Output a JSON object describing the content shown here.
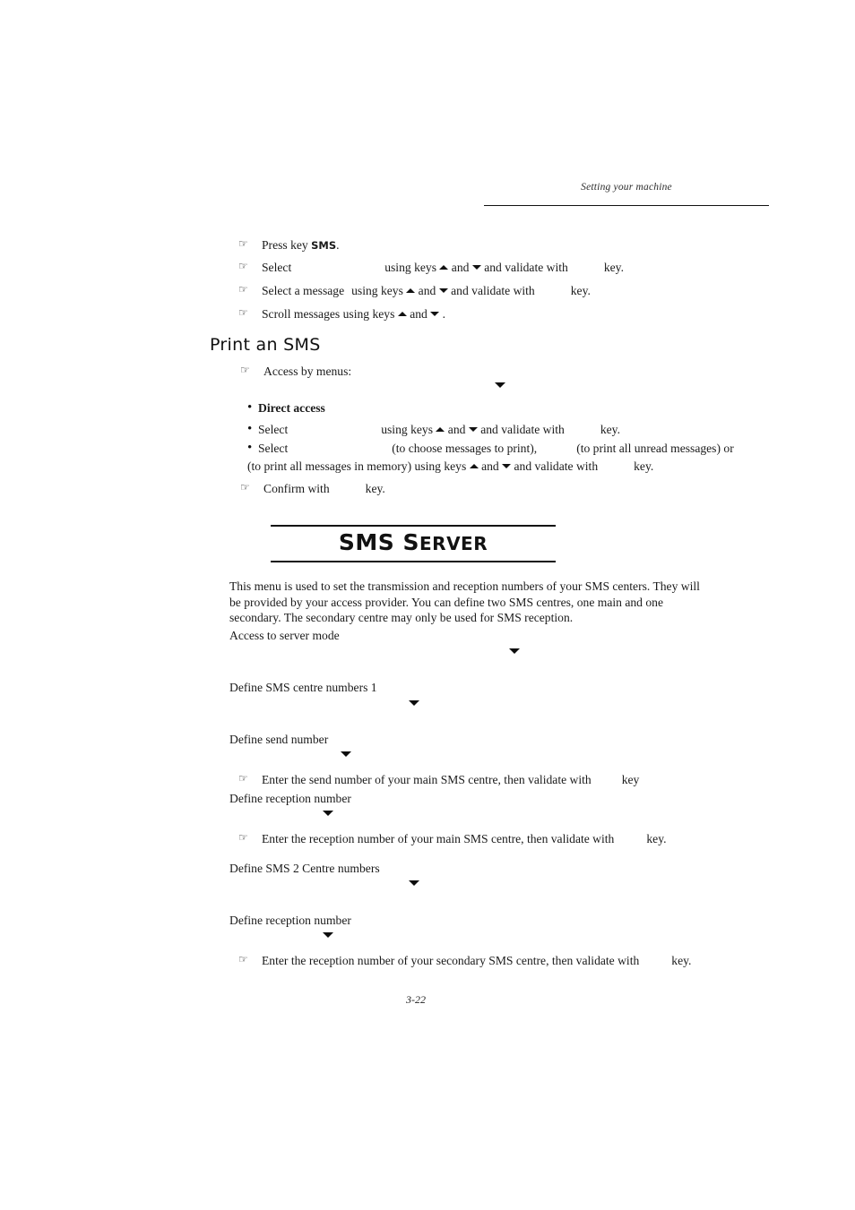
{
  "header": {
    "running_title": "Setting your machine"
  },
  "footer": {
    "page_number": "3-22"
  },
  "icons": {
    "hand": "☞",
    "bullet": "•",
    "key_up": "▲",
    "key_down": "▼",
    "menu_arrow": "▼"
  },
  "read_sms_steps": {
    "step1_pre": "Press key ",
    "step1_key": "SMS",
    "step1_post": ".",
    "step2_a": "Select",
    "step2_b": "using keys ",
    "step2_c": " and ",
    "step2_d": " and validate with",
    "step2_e": "key.",
    "step3_a": "Select a message",
    "step3_b": "using keys ",
    "step3_c": " and ",
    "step3_d": " and validate with",
    "step3_e": "key.",
    "step4_a": "Scroll messages using keys ",
    "step4_b": " and ",
    "step4_c": " ."
  },
  "print_sms": {
    "heading": "Print an SMS",
    "access_by_menus": "Access by menus:",
    "direct_access": "Direct access",
    "select1_a": "Select",
    "select1_b": "using keys ",
    "select1_c": " and ",
    "select1_d": " and validate with",
    "select1_e": "key.",
    "select2_a": "Select",
    "select2_b": "(to choose messages to print),",
    "select2_c": "(to print all unread messages) or",
    "select2_line2_a": "(to print all messages in memory) using keys ",
    "select2_line2_b": " and ",
    "select2_line2_c": " and validate with",
    "select2_line2_d": "key.",
    "confirm_a": "Confirm with",
    "confirm_b": "key."
  },
  "sms_server": {
    "title_bold": "SMS",
    "title_rest_first": " S",
    "title_rest_small": "ERVER",
    "paragraph": "This menu is used to set the transmission and reception numbers of your SMS centers. They will be provided by your access provider. You can define two SMS centres, one main and one secondary. The secondary centre may only be used for SMS reception.",
    "access_to_server_mode": "Access to server mode",
    "define_sms_centre_numbers_1": "Define SMS centre numbers 1",
    "define_send_number": "Define send number",
    "enter_send_number": "Enter the send number of your main SMS centre, then validate with",
    "enter_send_number_key": "key",
    "define_reception_number_1": "Define reception number",
    "enter_reception_number_main": "Enter the reception number of your main SMS centre, then validate with",
    "enter_reception_number_main_key": "key.",
    "define_sms_2_centre_numbers": "Define SMS 2 Centre numbers",
    "define_reception_number_2": "Define reception number",
    "enter_reception_number_secondary": "Enter the reception number of your secondary SMS centre, then validate with",
    "enter_reception_number_secondary_key": "key."
  }
}
